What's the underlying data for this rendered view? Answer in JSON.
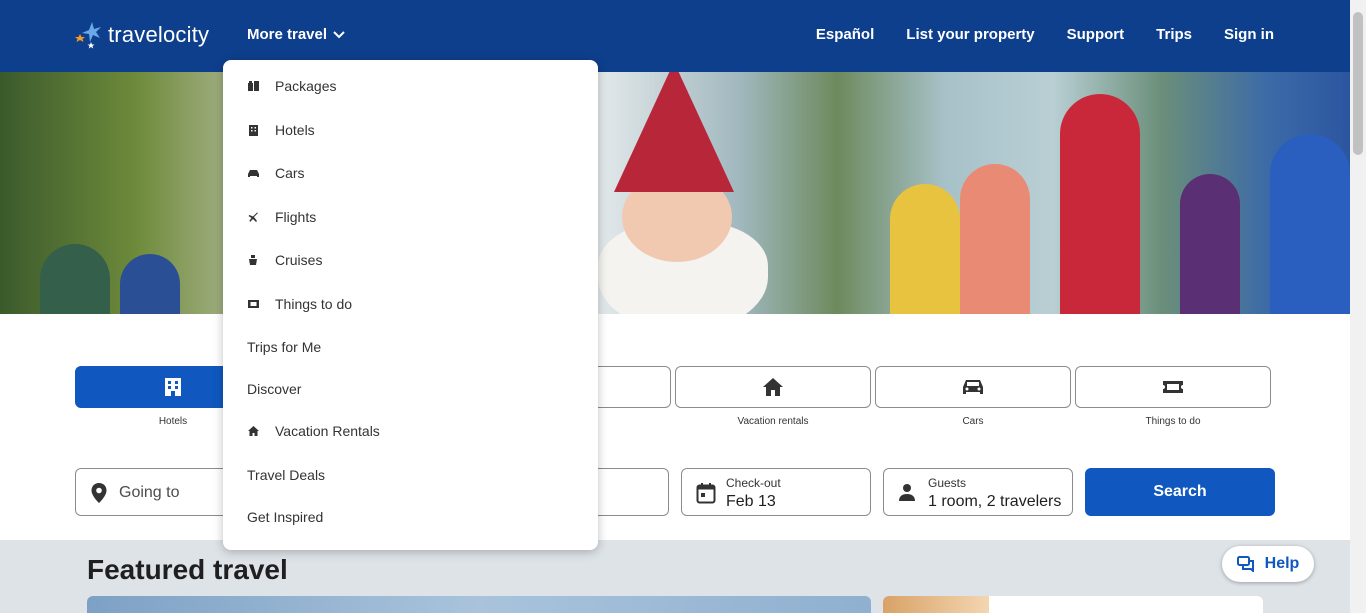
{
  "header": {
    "logo_text": "travelocity",
    "more_travel": "More travel",
    "nav": [
      "Español",
      "List your property",
      "Support",
      "Trips",
      "Sign in"
    ]
  },
  "dropdown": {
    "items": [
      {
        "label": "Packages",
        "icon": "packages-icon"
      },
      {
        "label": "Hotels",
        "icon": "hotel-icon"
      },
      {
        "label": "Cars",
        "icon": "car-icon"
      },
      {
        "label": "Flights",
        "icon": "plane-icon"
      },
      {
        "label": "Cruises",
        "icon": "cruise-icon"
      },
      {
        "label": "Things to do",
        "icon": "ticket-icon"
      },
      {
        "label": "Trips for Me",
        "icon": ""
      },
      {
        "label": "Discover",
        "icon": ""
      },
      {
        "label": "Vacation Rentals",
        "icon": "house-icon"
      },
      {
        "label": "Travel Deals",
        "icon": ""
      },
      {
        "label": "Get Inspired",
        "icon": ""
      }
    ]
  },
  "tabs": [
    {
      "label": "Hotels",
      "icon": "hotel-icon",
      "active": true
    },
    {
      "label": "",
      "icon": "",
      "active": false
    },
    {
      "label": "",
      "icon": "",
      "active": false
    },
    {
      "label": "Vacation rentals",
      "icon": "house-icon",
      "active": false
    },
    {
      "label": "Cars",
      "icon": "car-icon",
      "active": false
    },
    {
      "label": "Things to do",
      "icon": "ticket-icon",
      "active": false
    }
  ],
  "search": {
    "going_to_placeholder": "Going to",
    "checkout_label": "Check-out",
    "checkout_value": "Feb 13",
    "guests_label": "Guests",
    "guests_value": "1 room, 2 travelers",
    "search_button": "Search"
  },
  "featured": {
    "title": "Featured travel"
  },
  "help": {
    "label": "Help"
  },
  "colors": {
    "header_bg": "#0e3f8d",
    "accent": "#1058bf"
  }
}
